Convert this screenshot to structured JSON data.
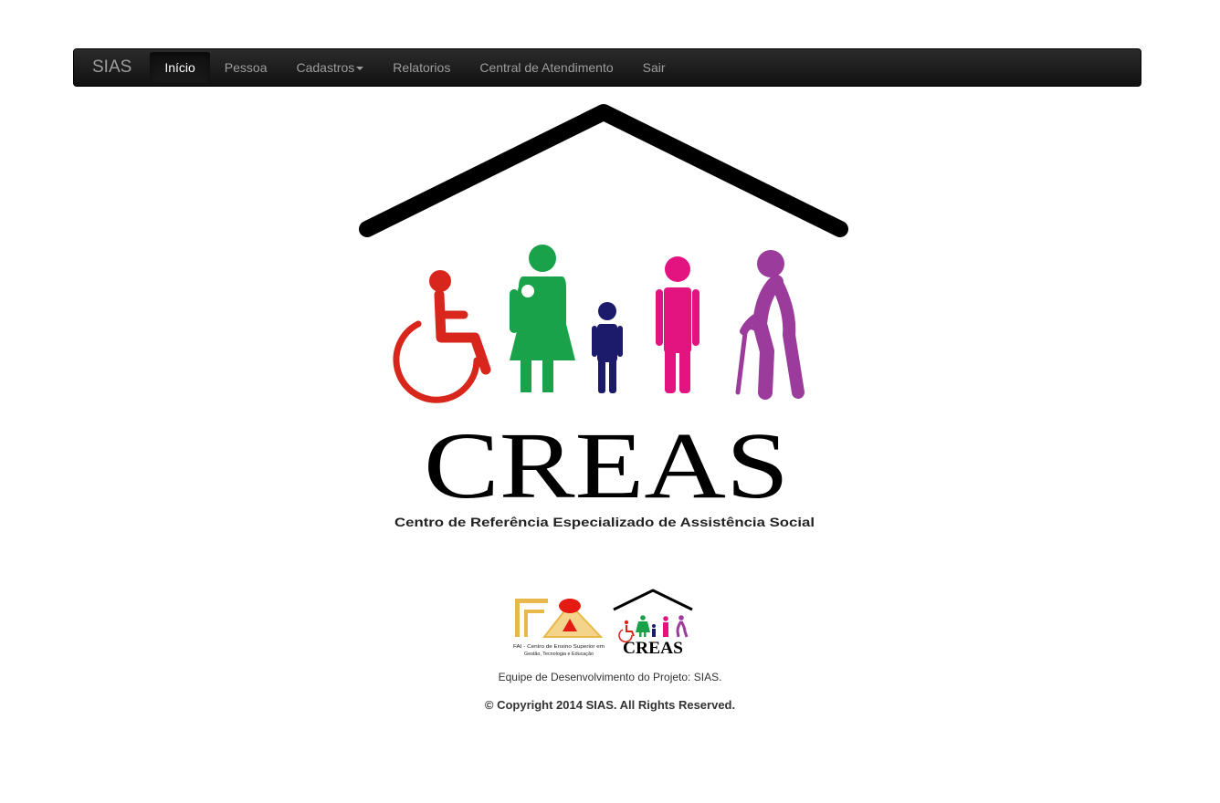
{
  "navbar": {
    "brand": "SIAS",
    "items": [
      {
        "label": "Início",
        "active": true
      },
      {
        "label": "Pessoa"
      },
      {
        "label": "Cadastros",
        "dropdown": true
      },
      {
        "label": "Relatorios"
      },
      {
        "label": "Central de Atendimento"
      },
      {
        "label": "Sair"
      }
    ]
  },
  "hero": {
    "logo_text": "CREAS",
    "logo_subtitle": "Centro de Referência Especializado de Assistência Social"
  },
  "footer": {
    "fai_caption_1": "FAI - Centro de Ensino Superior em",
    "fai_caption_2": "Gestão, Tecnologia e Educação",
    "small_logo_text": "CREAS",
    "team": "Equipe de Desenvolvimento do Projeto: SIAS.",
    "copyright": "© Copyright 2014 SIAS. All Rights Reserved."
  },
  "colors": {
    "red": "#d9261c",
    "green": "#1aa24a",
    "navy": "#1c1a6b",
    "magenta": "#e3137f",
    "purple": "#9b3b9b",
    "gold": "#e8b94a"
  }
}
